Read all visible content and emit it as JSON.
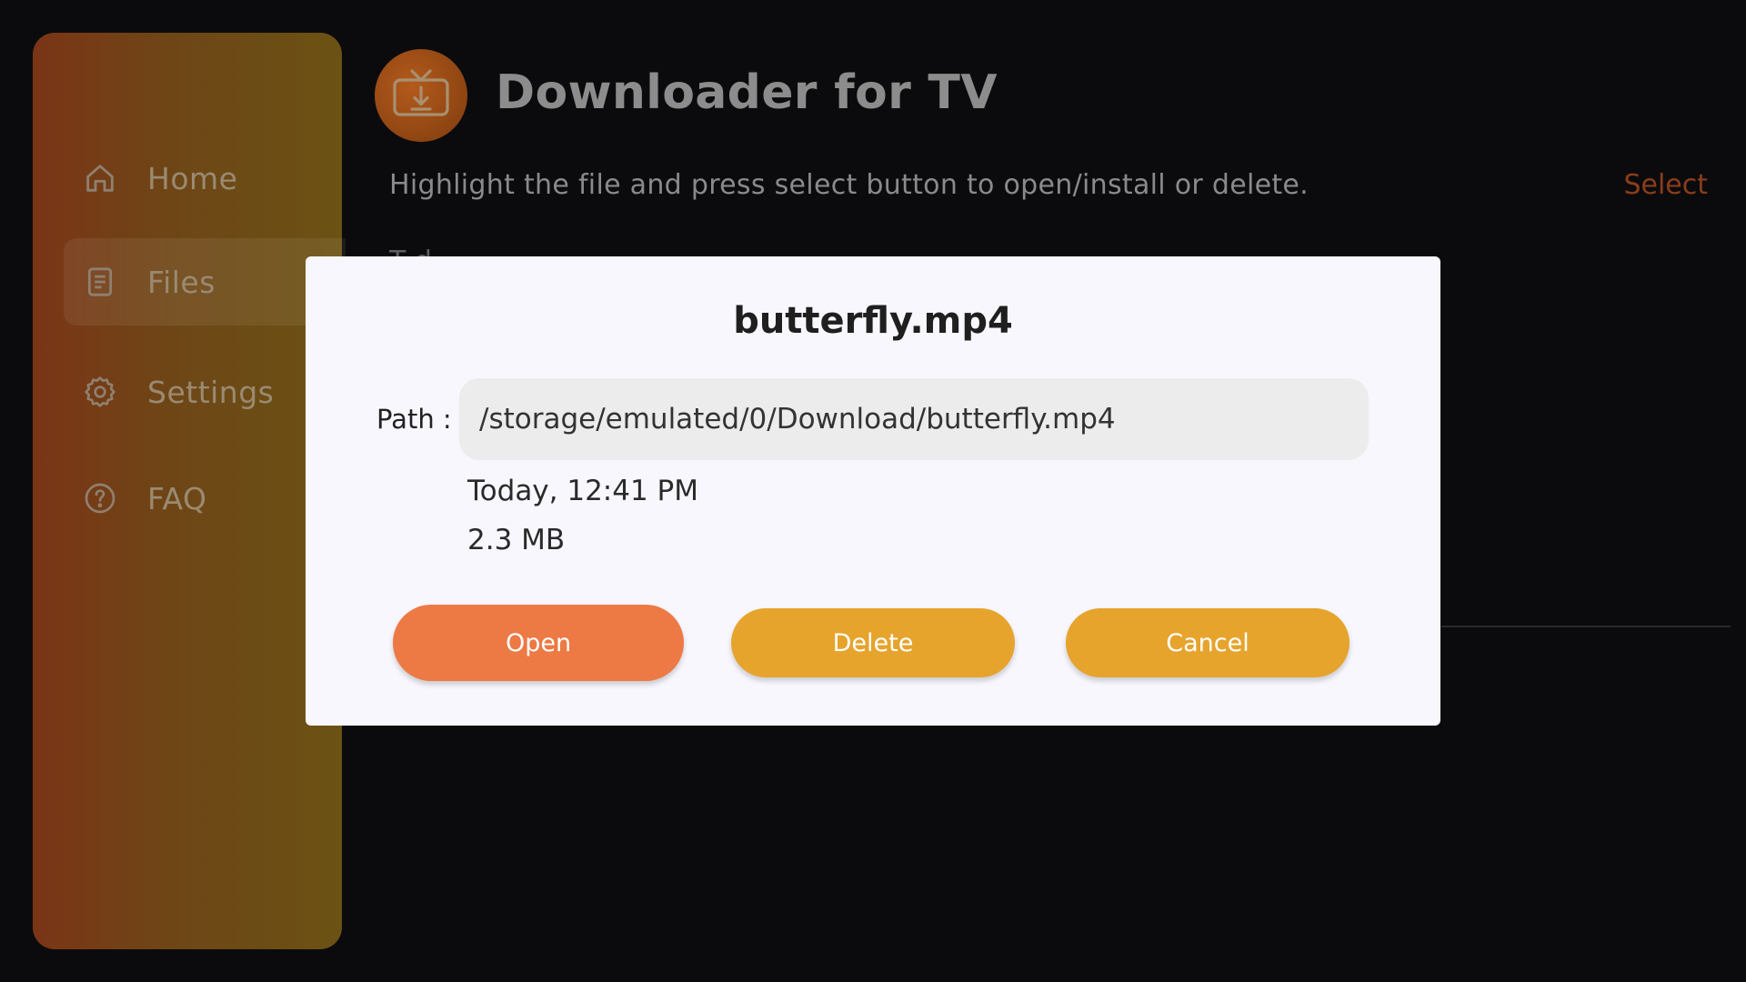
{
  "app": {
    "title": "Downloader for TV",
    "logo_icon": "tv-download-icon"
  },
  "sidebar": {
    "items": [
      {
        "label": "Home",
        "icon": "home-icon",
        "active": false
      },
      {
        "label": "Files",
        "icon": "file-icon",
        "active": true
      },
      {
        "label": "Settings",
        "icon": "gear-icon",
        "active": false
      },
      {
        "label": "FAQ",
        "icon": "help-circle-icon",
        "active": false
      }
    ]
  },
  "header": {
    "instruction": "Highlight the file and press select button to open/install or delete.",
    "select_label": "Select",
    "partial_text": "T d"
  },
  "dialog": {
    "title": "butterfly.mp4",
    "path_label": "Path :",
    "path_value": "/storage/emulated/0/Download/butterfly.mp4",
    "date": "Today, 12:41 PM",
    "size": "2.3 MB",
    "buttons": {
      "open": "Open",
      "delete": "Delete",
      "cancel": "Cancel"
    }
  },
  "colors": {
    "accent_open": "#ed7944",
    "accent_secondary": "#e6a42d",
    "select_link": "#8a3d1a"
  }
}
